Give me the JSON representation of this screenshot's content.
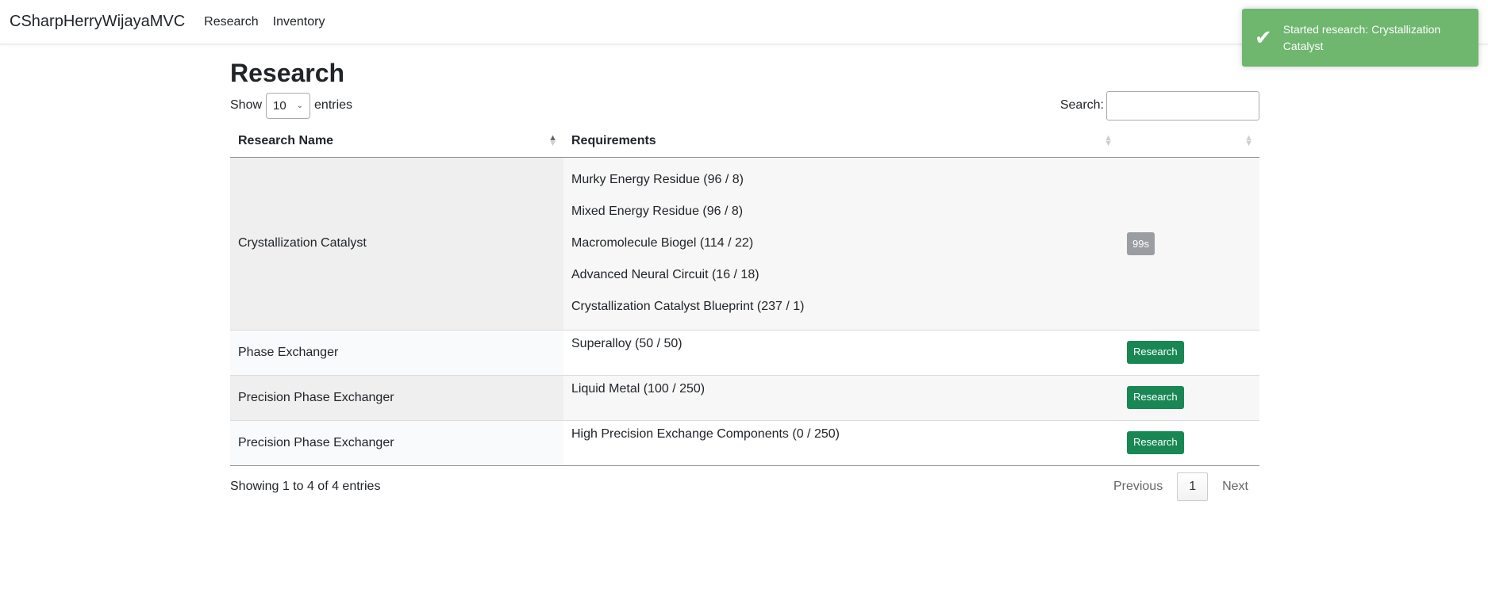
{
  "navbar": {
    "brand": "CSharpHerryWijayaMVC",
    "links": [
      "Research",
      "Inventory"
    ]
  },
  "page": {
    "title": "Research"
  },
  "length_control": {
    "show_label": "Show",
    "value": "10",
    "entries_label": "entries"
  },
  "search": {
    "label": "Search:",
    "value": ""
  },
  "table": {
    "headers": [
      "Research Name",
      "Requirements",
      ""
    ],
    "rows": [
      {
        "name": "Crystallization Catalyst",
        "requirements": [
          "Murky Energy Residue (96 / 8)",
          "Mixed Energy Residue (96 / 8)",
          "Macromolecule Biogel (114 / 22)",
          "Advanced Neural Circuit (16 / 18)",
          "Crystallization Catalyst Blueprint (237 / 1)"
        ],
        "action": "99s"
      },
      {
        "name": "Phase Exchanger",
        "requirements": [
          "Superalloy (50 / 50)"
        ],
        "action": "Research"
      },
      {
        "name": "Precision Phase Exchanger",
        "requirements": [
          "Liquid Metal (100 / 250)"
        ],
        "action": "Research"
      },
      {
        "name": "Precision Phase Exchanger",
        "requirements": [
          "High Precision Exchange Components (0 / 250)"
        ],
        "action": "Research"
      }
    ]
  },
  "footer": {
    "info": "Showing 1 to 4 of 4 entries",
    "previous": "Previous",
    "current_page": "1",
    "next": "Next"
  },
  "toast": {
    "message": "Started research: Crystallization Catalyst",
    "icon": "check-icon"
  },
  "colors": {
    "success_button": "#198754",
    "toast_bg": "#6fb66f",
    "badge_bg": "#9a9ea3"
  }
}
